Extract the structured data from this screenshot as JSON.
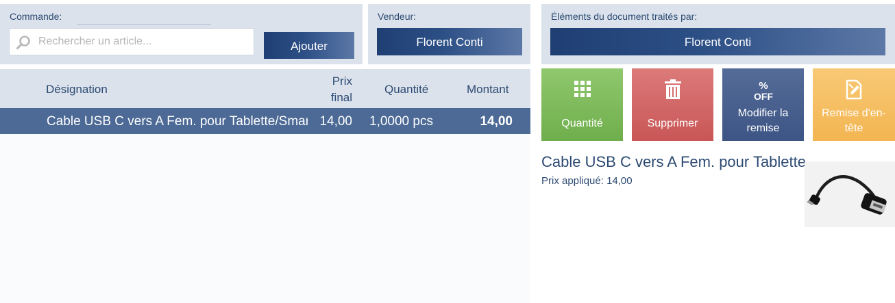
{
  "order": {
    "label": "Commande:",
    "search_placeholder": "Rechercher un article...",
    "add_label": "Ajouter"
  },
  "seller": {
    "label": "Vendeur:",
    "name": "Florent Conti"
  },
  "handler": {
    "label": "Éléments du document traités par:",
    "name": "Florent Conti"
  },
  "table": {
    "columns": {
      "designation": "Désignation",
      "price": "Prix final",
      "quantity": "Quantité",
      "amount": "Montant"
    },
    "rows": [
      {
        "designation": "Cable USB C vers A Fem. pour Tablette/Smartphone",
        "price": "14,00",
        "quantity": "1,0000 pcs",
        "amount": "14,00"
      }
    ]
  },
  "actions": {
    "quantity": {
      "label": "Quantité",
      "icon": "grid-icon",
      "color": "#7fbb5a"
    },
    "delete": {
      "label": "Supprimer",
      "icon": "trash-icon",
      "color": "#d36868"
    },
    "modify_discount": {
      "label": "Modifier la remise",
      "icon_text": "%\nOFF",
      "icon": "percent-off-icon",
      "color": "#4a6290"
    },
    "header_discount": {
      "label": "Remise d'en-tête",
      "icon": "document-edit-icon",
      "color": "#f5be62"
    }
  },
  "detail": {
    "name": "Cable USB C vers A Fem. pour Tablette/Smartphone",
    "price_label": "Prix appliqué:",
    "price_value": "14,00",
    "image_icon": "usb-otg-cable-image"
  },
  "colors": {
    "panel_bg": "#dbe2ec",
    "accent_blue": "#2c4a72",
    "selected_row": "#4c6a95"
  }
}
